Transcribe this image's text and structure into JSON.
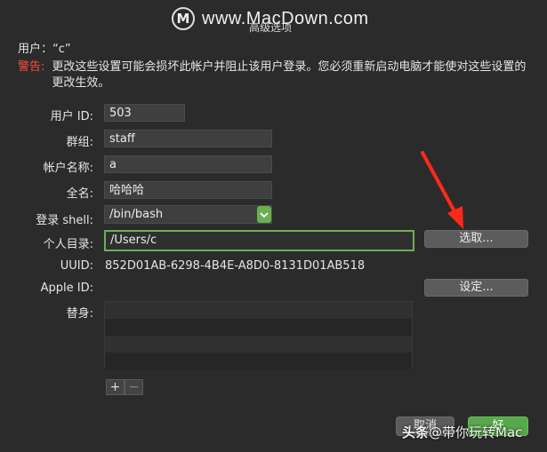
{
  "watermark": {
    "logo": "M",
    "text": "www.MacDown.com"
  },
  "dialog": {
    "title": "高级选项"
  },
  "user_line": "用户：“c”",
  "warning": {
    "label": "警告:",
    "text": "更改这些设置可能会损坏此帐户并阻止该用户登录。您必须重新启动电脑才能使对这些设置的更改生效。"
  },
  "fields": {
    "user_id": {
      "label": "用户 ID:",
      "value": "503"
    },
    "group": {
      "label": "群组:",
      "value": "staff"
    },
    "account_name": {
      "label": "帐户名称:",
      "value": "a"
    },
    "full_name": {
      "label": "全名:",
      "value": "哈哈哈"
    },
    "login_shell": {
      "label": "登录 shell:",
      "value": "/bin/bash"
    },
    "home_dir": {
      "label": "个人目录:",
      "value": "/Users/c"
    },
    "uuid": {
      "label": "UUID:",
      "value": "852D01AB-6298-4B4E-A8D0-8131D01AB518"
    },
    "apple_id": {
      "label": "Apple ID:"
    },
    "aliases": {
      "label": "替身:"
    }
  },
  "buttons": {
    "choose": "选取...",
    "set": "设定...",
    "add": "+",
    "remove": "−",
    "cancel": "取消",
    "ok": "好"
  },
  "credit": {
    "brand": "头条",
    "text": "@带你玩转Mac"
  },
  "colors": {
    "accent_green": "#6ab04c",
    "warning_red": "#ff4b3a",
    "arrow_red": "#ff2a1a"
  }
}
